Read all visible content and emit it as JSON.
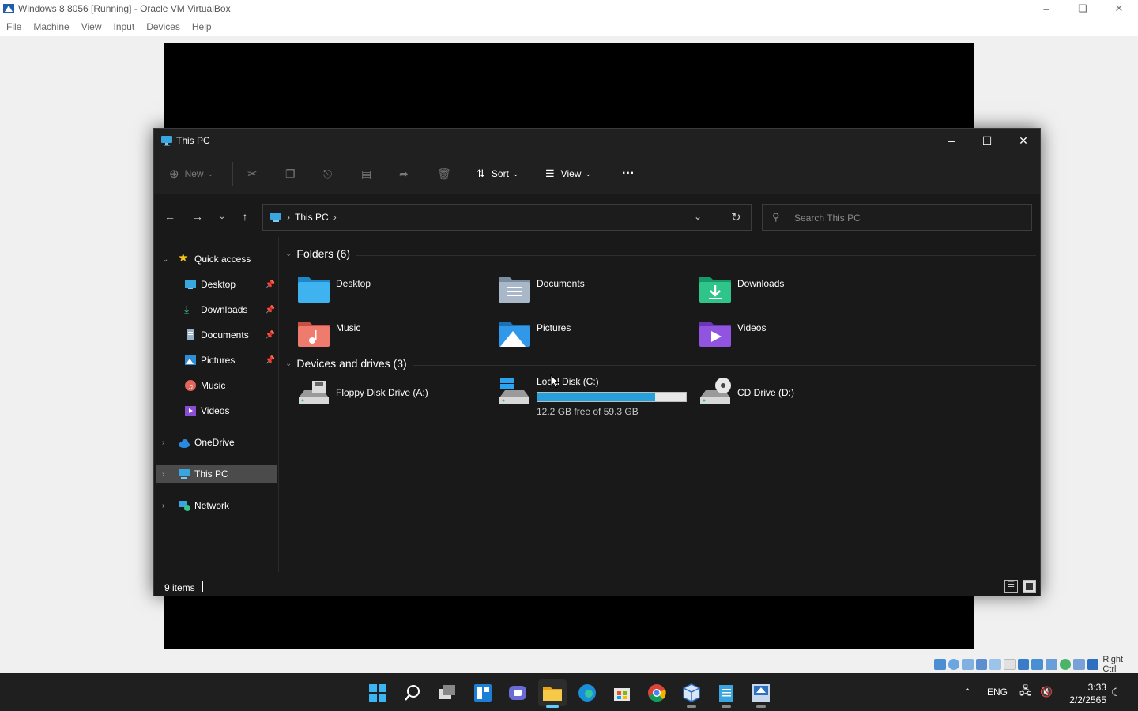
{
  "vbox": {
    "title": "Windows 8 8056 [Running] - Oracle VM VirtualBox",
    "menu": [
      "File",
      "Machine",
      "View",
      "Input",
      "Devices",
      "Help"
    ],
    "status_right": "Right Ctrl"
  },
  "explorer": {
    "title": "This PC",
    "toolbar": {
      "new_label": "New",
      "sort_label": "Sort",
      "view_label": "View"
    },
    "address": {
      "crumb": "This PC"
    },
    "search": {
      "placeholder": "Search This PC"
    },
    "nav": {
      "quick_access": "Quick access",
      "pinned": [
        {
          "label": "Desktop",
          "icon": "desktop-icon",
          "pinned": true
        },
        {
          "label": "Downloads",
          "icon": "downloads-icon",
          "pinned": true
        },
        {
          "label": "Documents",
          "icon": "documents-icon",
          "pinned": true
        },
        {
          "label": "Pictures",
          "icon": "pictures-icon",
          "pinned": true
        },
        {
          "label": "Music",
          "icon": "music-icon",
          "pinned": false
        },
        {
          "label": "Videos",
          "icon": "videos-icon",
          "pinned": false
        }
      ],
      "onedrive": "OneDrive",
      "this_pc": "This PC",
      "network": "Network"
    },
    "folders": {
      "header": "Folders (6)",
      "items": [
        {
          "name": "Desktop",
          "icon": "desktop-folder-icon"
        },
        {
          "name": "Documents",
          "icon": "documents-folder-icon"
        },
        {
          "name": "Downloads",
          "icon": "downloads-folder-icon"
        },
        {
          "name": "Music",
          "icon": "music-folder-icon"
        },
        {
          "name": "Pictures",
          "icon": "pictures-folder-icon"
        },
        {
          "name": "Videos",
          "icon": "videos-folder-icon"
        }
      ]
    },
    "drives": {
      "header": "Devices and drives (3)",
      "items": [
        {
          "name": "Floppy Disk Drive (A:)",
          "icon": "floppy-drive-icon"
        },
        {
          "name": "Local Disk (C:)",
          "icon": "local-disk-icon",
          "free_text": "12.2 GB free of 59.3 GB",
          "used_fraction": 0.794
        },
        {
          "name": "CD Drive (D:)",
          "icon": "cd-drive-icon"
        }
      ]
    },
    "status": {
      "count": "9 items"
    }
  },
  "taskbar": {
    "apps": [
      "start-icon",
      "search-icon",
      "task-view-icon",
      "widgets-icon",
      "chat-icon",
      "file-explorer-icon",
      "edge-icon",
      "store-icon",
      "chrome-icon",
      "virtualbox-icon",
      "notepad-icon",
      "vbox-manager-icon"
    ],
    "lang": "ENG",
    "time": "3:33",
    "date": "2/2/2565"
  },
  "colors": {
    "explorer_bg": "#191919",
    "accent": "#26a0da",
    "selected_nav": "#4b4b4b"
  }
}
